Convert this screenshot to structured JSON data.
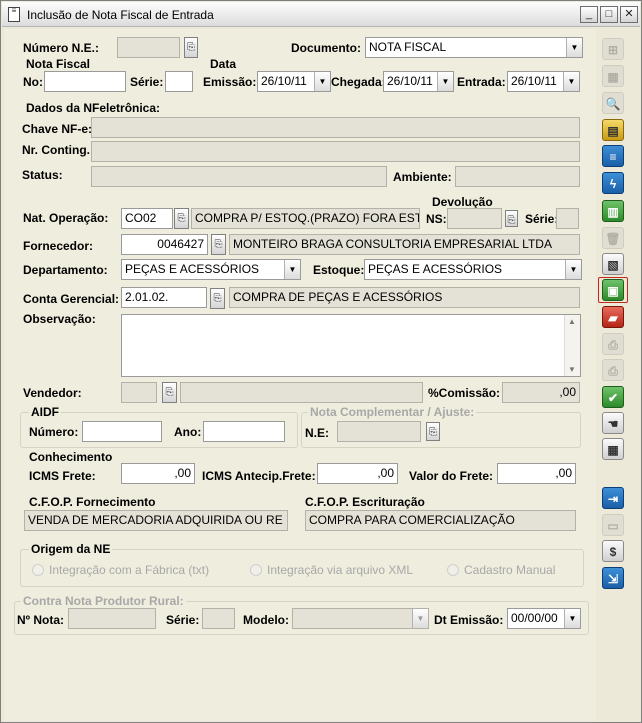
{
  "window": {
    "title": "Inclusão de Nota Fiscal de Entrada",
    "min": "_",
    "max": "□",
    "close": "✕"
  },
  "header": {
    "numero_ne_label": "Número N.E.:",
    "numero_ne_value": "",
    "documento_label": "Documento:",
    "documento_value": "NOTA FISCAL",
    "nota_fiscal_title": "Nota Fiscal",
    "data_title": "Data",
    "no_label": "No:",
    "no_value": "",
    "serie_label": "Série:",
    "serie_value": "",
    "emissao_label": "Emissão:",
    "emissao_value": "26/10/11",
    "chegada_label": "Chegada:",
    "chegada_value": "26/10/11",
    "entrada_label": "Entrada:",
    "entrada_value": "26/10/11"
  },
  "nfe": {
    "title": "Dados da NFeletrônica:",
    "chave_label": "Chave NF-e:",
    "chave_value": "",
    "conting_label": "Nr. Conting.:",
    "conting_value": "",
    "status_label": "Status:",
    "status_value": "",
    "ambiente_label": "Ambiente:",
    "ambiente_value": ""
  },
  "operacao": {
    "devolucao_title": "Devolução",
    "nat_label": "Nat. Operação:",
    "nat_code": "CO02",
    "nat_desc": "COMPRA P/ ESTOQ.(PRAZO) FORA ESTADO",
    "ns_label": "NS:",
    "ns_value": "",
    "dev_serie_label": "Série:",
    "dev_serie_value": "",
    "fornecedor_label": "Fornecedor:",
    "fornecedor_code": "0046427",
    "fornecedor_name": "MONTEIRO BRAGA CONSULTORIA EMPRESARIAL LTDA",
    "departamento_label": "Departamento:",
    "departamento_value": "PEÇAS E ACESSÓRIOS",
    "estoque_label": "Estoque:",
    "estoque_value": "PEÇAS E ACESSÓRIOS",
    "conta_label": "Conta Gerencial:",
    "conta_code": "2.01.02.",
    "conta_desc": "COMPRA DE PEÇAS E ACESSÓRIOS",
    "obs_label": "Observação:",
    "obs_value": "",
    "vendedor_label": "Vendedor:",
    "vendedor_code": "",
    "vendedor_name": "",
    "comissao_label": "%Comissão:",
    "comissao_value": ",00"
  },
  "aidf": {
    "title": "AIDF",
    "numero_label": "Número:",
    "numero_value": "",
    "ano_label": "Ano:",
    "ano_value": ""
  },
  "complementar": {
    "title": "Nota Complementar / Ajuste:",
    "ne_label": "N.E:",
    "ne_value": ""
  },
  "conhecimento": {
    "title": "Conhecimento",
    "icms_frete_label": "ICMS Frete:",
    "icms_frete_value": ",00",
    "icms_antecip_label": "ICMS Antecip.Frete:",
    "icms_antecip_value": ",00",
    "valor_frete_label": "Valor do Frete:",
    "valor_frete_value": ",00"
  },
  "cfop": {
    "fornecimento_title": "C.F.O.P. Fornecimento",
    "fornecimento_value": "VENDA DE MERCADORIA ADQUIRIDA OU RE",
    "escrituracao_title": "C.F.O.P. Escrituração",
    "escrituracao_value": "COMPRA PARA COMERCIALIZAÇÃO"
  },
  "origem": {
    "title": "Origem da NE",
    "options": [
      "Integração com a Fábrica (txt)",
      "Integração via arquivo XML",
      "Cadastro Manual"
    ]
  },
  "produtor": {
    "title": "Contra Nota Produtor Rural:",
    "nota_label": "Nº Nota:",
    "nota_value": "",
    "serie_label": "Série:",
    "serie_value": "",
    "modelo_label": "Modelo:",
    "modelo_value": "",
    "dt_label": "Dt Emissão:",
    "dt_value": "00/00/00"
  },
  "toolbar": [
    {
      "name": "insert-row-icon",
      "glyph": "⊞"
    },
    {
      "name": "edit-grid-icon",
      "glyph": "▦"
    },
    {
      "name": "preview-icon",
      "glyph": "🔍"
    },
    {
      "name": "open-folder-icon",
      "glyph": "▤"
    },
    {
      "name": "list-icon",
      "glyph": "≡"
    },
    {
      "name": "lightning-icon",
      "glyph": "ϟ"
    },
    {
      "name": "book-icon",
      "glyph": "▥"
    },
    {
      "name": "trash-icon",
      "glyph": "🗑"
    },
    {
      "name": "save-list-icon",
      "glyph": "▧"
    },
    {
      "name": "stack-transfer-icon",
      "glyph": "▣"
    },
    {
      "name": "truck-icon",
      "glyph": "▰"
    },
    {
      "name": "print-icon",
      "glyph": "⎙"
    },
    {
      "name": "print-preview-icon",
      "glyph": "⎙"
    },
    {
      "name": "approve-icon",
      "glyph": "✔"
    },
    {
      "name": "hand-icon",
      "glyph": "☚"
    },
    {
      "name": "calculator-icon",
      "glyph": "▦"
    },
    {
      "name": "import-icon",
      "glyph": "⇥"
    },
    {
      "name": "folder-open-icon",
      "glyph": "▭"
    },
    {
      "name": "money-icon",
      "glyph": "$"
    },
    {
      "name": "exit-icon",
      "glyph": "⇲"
    }
  ]
}
